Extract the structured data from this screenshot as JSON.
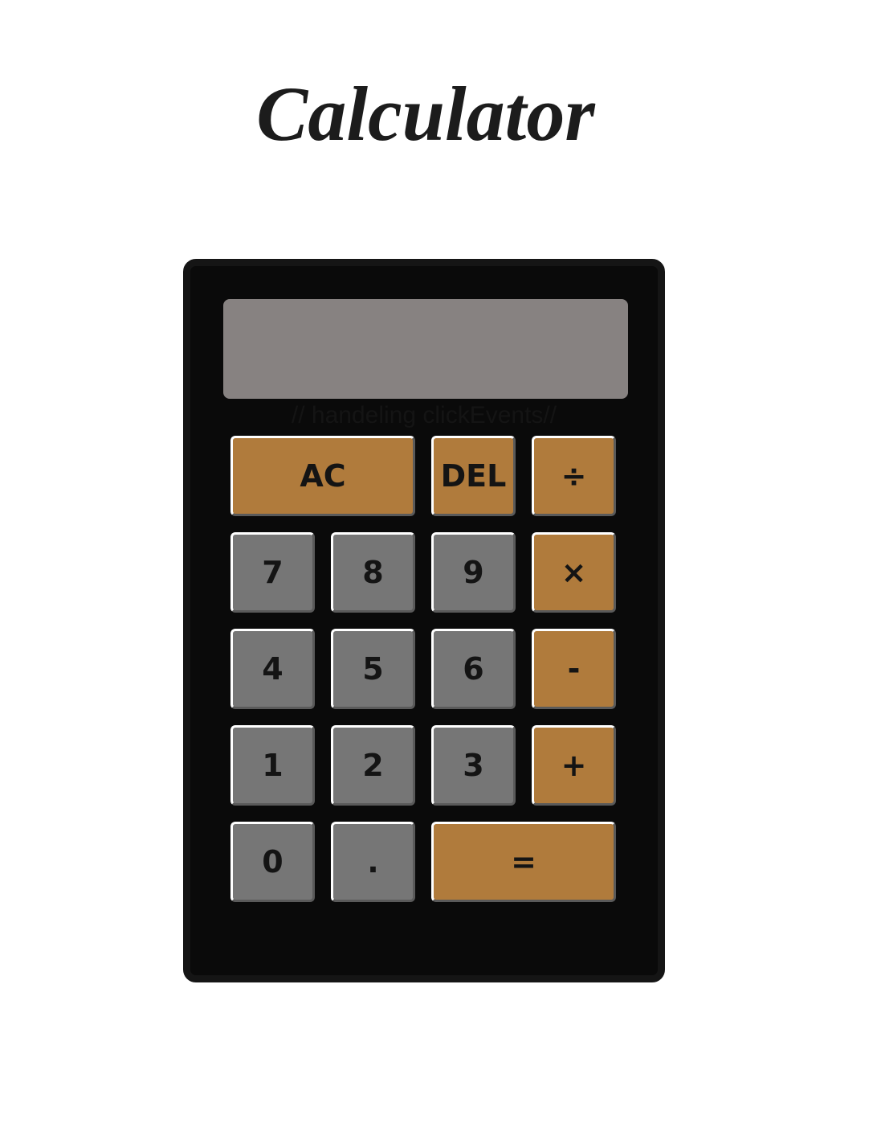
{
  "page": {
    "title": "Calculator"
  },
  "calculator": {
    "display_value": "",
    "comment_text": "// handeling clickEvents//",
    "colors": {
      "body": "#0a0a0a",
      "display": "#878281",
      "number_key": "#767676",
      "operator_key": "#b07b3c"
    },
    "keys": {
      "ac": "AC",
      "del": "DEL",
      "divide": "÷",
      "seven": "7",
      "eight": "8",
      "nine": "9",
      "multiply": "×",
      "four": "4",
      "five": "5",
      "six": "6",
      "minus": "-",
      "one": "1",
      "two": "2",
      "three": "3",
      "plus": "+",
      "zero": "0",
      "decimal": ".",
      "equals": "="
    }
  }
}
